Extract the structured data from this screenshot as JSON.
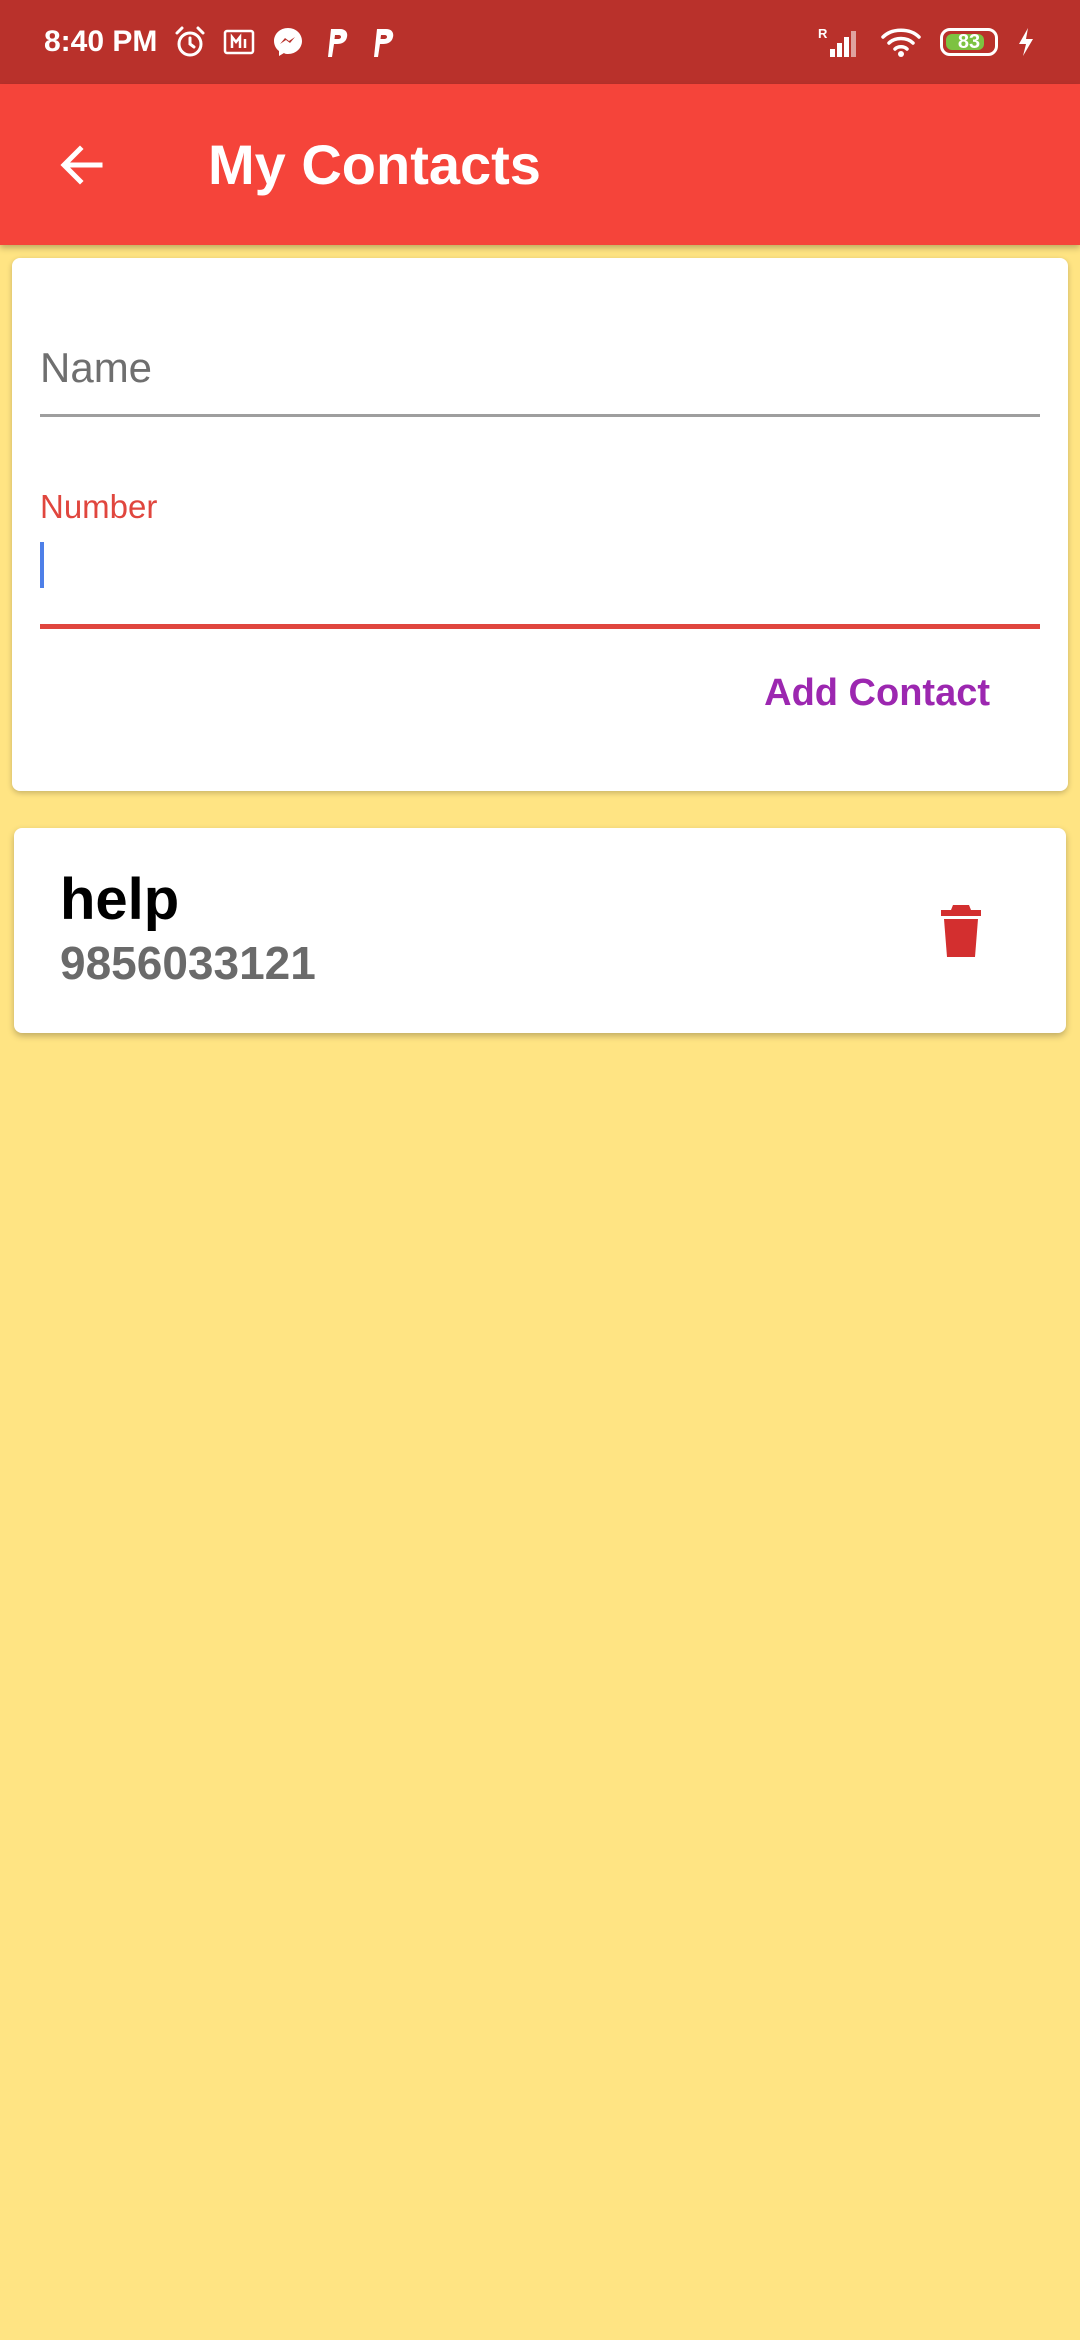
{
  "status_bar": {
    "time": "8:40 PM",
    "left_icons": [
      "alarm-icon",
      "mi-icon",
      "messenger-icon",
      "p-icon",
      "p-icon"
    ],
    "right_icons": [
      "signal-icon",
      "wifi-icon",
      "battery-icon",
      "charging-icon"
    ],
    "signal_prefix": "R",
    "battery_level": "83",
    "battery_color": "#7DC241"
  },
  "app_bar": {
    "title": "My Contacts",
    "back_icon": "arrow-back-icon",
    "color": "#F5443A"
  },
  "form": {
    "name_placeholder": "Name",
    "number_label": "Number",
    "number_value": "",
    "add_button_label": "Add Contact",
    "accent_color": "#E0463E",
    "button_color": "#9C27B0"
  },
  "contacts": [
    {
      "name": "help",
      "number": "9856033121",
      "delete_icon": "trash-icon",
      "delete_color": "#D32F2F"
    }
  ],
  "background_color": "#FFE483"
}
